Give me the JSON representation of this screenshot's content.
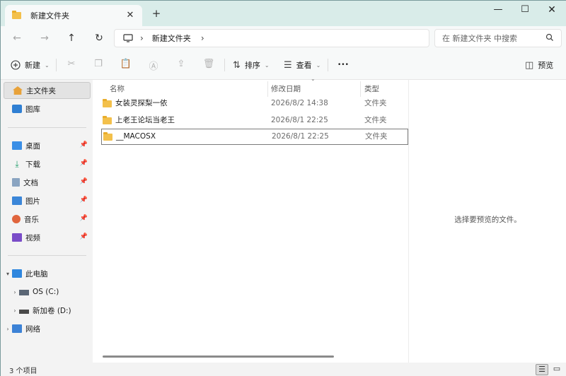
{
  "window": {
    "tab_title": "新建文件夹",
    "tab_close": "✕",
    "new_tab": "+",
    "minimize": "—",
    "maximize": "☐",
    "close": "✕"
  },
  "nav": {
    "back": "←",
    "forward": "→",
    "up": "↑",
    "refresh": "↻",
    "address_segments": [
      "新建文件夹"
    ],
    "search_placeholder": "在 新建文件夹 中搜索"
  },
  "commandbar": {
    "new_label": "新建",
    "sort_label": "排序",
    "view_label": "查看",
    "more_label": "•••",
    "preview_label": "预览"
  },
  "sidebar": {
    "quick": [
      {
        "label": "主文件夹",
        "active": true
      },
      {
        "label": "图库"
      }
    ],
    "pinned": [
      {
        "label": "桌面"
      },
      {
        "label": "下载"
      },
      {
        "label": "文档"
      },
      {
        "label": "图片"
      },
      {
        "label": "音乐"
      },
      {
        "label": "视频"
      }
    ],
    "computer": {
      "label": "此电脑",
      "expand": "▾"
    },
    "drives": [
      {
        "label": "OS (C:)",
        "expand": "›"
      },
      {
        "label": "新加卷 (D:)",
        "expand": "›"
      }
    ],
    "network": {
      "label": "网络",
      "expand": "›"
    }
  },
  "filelist": {
    "columns": {
      "name": "名称",
      "date": "修改日期",
      "type": "类型"
    },
    "rows": [
      {
        "name": "女装灵探梨一依",
        "date": "2026/8/2 14:38",
        "type": "文件夹"
      },
      {
        "name": "上老王论坛当老王",
        "date": "2026/8/1 22:25",
        "type": "文件夹"
      },
      {
        "name": "__MACOSX",
        "date": "2026/8/1 22:25",
        "type": "文件夹",
        "focused": true
      }
    ]
  },
  "preview": {
    "message": "选择要预览的文件。"
  },
  "status": {
    "item_count": "3 个项目"
  },
  "colors": {
    "titlebar": "#d9ece9",
    "folder": "#f3c04b",
    "accent": "#0067c0"
  }
}
